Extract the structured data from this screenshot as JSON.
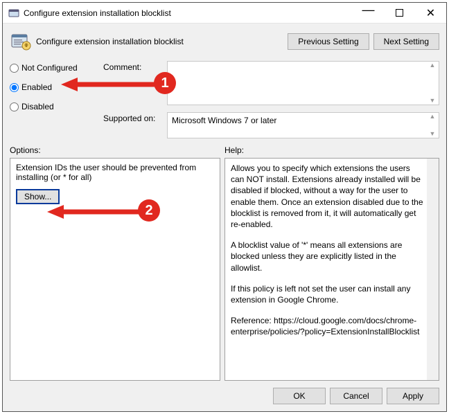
{
  "titlebar": {
    "title": "Configure extension installation blocklist"
  },
  "header": {
    "policy_title": "Configure extension installation blocklist",
    "previous": "Previous Setting",
    "next": "Next Setting"
  },
  "state": {
    "not_configured": "Not Configured",
    "enabled": "Enabled",
    "disabled": "Disabled",
    "selected": "enabled"
  },
  "comment": {
    "label": "Comment:",
    "value": ""
  },
  "supported": {
    "label": "Supported on:",
    "value": "Microsoft Windows 7 or later"
  },
  "labels": {
    "options": "Options:",
    "help": "Help:"
  },
  "options": {
    "prompt": "Extension IDs the user should be prevented from installing (or * for all)",
    "show": "Show..."
  },
  "help": {
    "p1": "Allows you to specify which extensions the users can NOT install. Extensions already installed will be disabled if blocked, without a way for the user to enable them. Once an extension disabled due to the blocklist is removed from it, it will automatically get re-enabled.",
    "p2": "A blocklist value of '*' means all extensions are blocked unless they are explicitly listed in the allowlist.",
    "p3": "If this policy is left not set the user can install any extension in Google Chrome.",
    "p4": "Reference: https://cloud.google.com/docs/chrome-enterprise/policies/?policy=ExtensionInstallBlocklist"
  },
  "footer": {
    "ok": "OK",
    "cancel": "Cancel",
    "apply": "Apply"
  },
  "annotations": {
    "one": "1",
    "two": "2"
  }
}
